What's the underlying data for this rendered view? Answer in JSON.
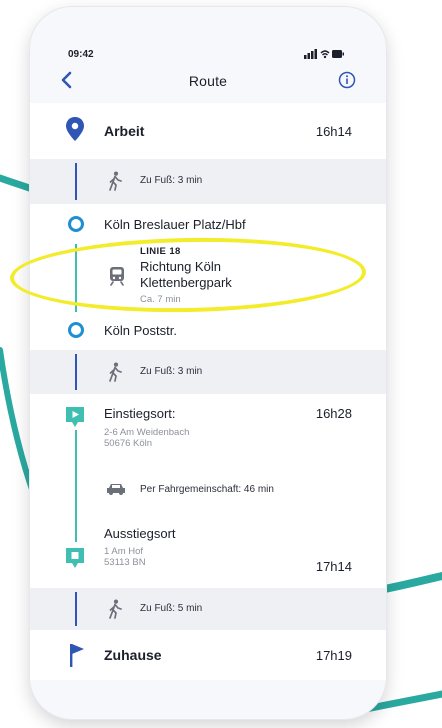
{
  "status": {
    "time": "09:42"
  },
  "nav": {
    "title": "Route"
  },
  "route": {
    "start": {
      "label": "Arbeit",
      "time": "16h14"
    },
    "walk1": "Zu Fuß: 3 min",
    "stop1": "Köln Breslauer Platz/Hbf",
    "transit": {
      "line": "LINIE 18",
      "direction_line1": "Richtung Köln",
      "direction_line2": "Klettenbergpark",
      "duration": "Ca. 7 min"
    },
    "stop2": "Köln Poststr.",
    "walk2": "Zu Fuß: 3 min",
    "pickup": {
      "label": "Einstiegsort:",
      "time": "16h28",
      "addr1": "2-6 Am Weidenbach",
      "addr2": "50676 Köln"
    },
    "carpool": "Per Fahrgemeinschaft: 46 min",
    "dropoff": {
      "label": "Ausstiegsort",
      "addr1": "1 Am Hof",
      "addr2": "53113 BN",
      "time": "17h14"
    },
    "walk3": "Zu Fuß: 5 min",
    "end": {
      "label": "Zuhause",
      "time": "17h19"
    }
  },
  "colors": {
    "primary": "#2f55b5",
    "teal": "#3fbfb2",
    "stop_ring": "#1e8fd3",
    "highlight": "#f2ec2a"
  }
}
